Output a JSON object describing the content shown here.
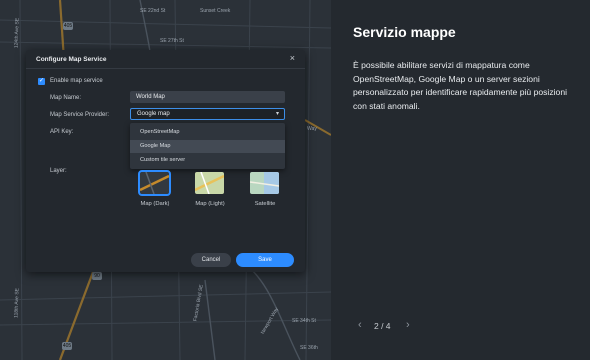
{
  "map": {
    "street_labels": {
      "se_22nd": "SE 22nd St",
      "se_27th": "SE 27th St",
      "sunset_creek": "Sunset Creek",
      "way": "Way",
      "ave_124th": "124th Ave SE",
      "ave_118th": "118th Ave SE",
      "factoria": "Factoria Blvd SE",
      "newport": "Newport Way",
      "se_34th": "SE 34th St",
      "se_36th": "SE 36th"
    },
    "shields": [
      "405",
      "90",
      "405"
    ]
  },
  "dialog": {
    "title": "Configure Map Service",
    "close_glyph": "×",
    "enable_label": "Enable map service",
    "map_name_label": "Map Name:",
    "map_name_value": "World Map",
    "provider_label": "Map Service Provider:",
    "provider_value": "Google map",
    "provider_options": [
      "OpenStreetMap",
      "Google Map",
      "Custom tile server"
    ],
    "api_key_label": "API Key:",
    "layer_label": "Layer:",
    "layers": [
      {
        "label": "Map (Dark)",
        "selected": true
      },
      {
        "label": "Map (Light)",
        "selected": false
      },
      {
        "label": "Satellite",
        "selected": false
      }
    ],
    "cancel_label": "Cancel",
    "save_label": "Save"
  },
  "info": {
    "title": "Servizio mappe",
    "body": "È possibile abilitare servizi di mappatura come OpenStreetMap, Google Map o un server sezioni personalizzato per identificare rapidamente più posizioni con stati anomali.",
    "pager": {
      "current": "2",
      "total": "4",
      "text": "2 / 4",
      "prev_glyph": "‹",
      "next_glyph": "›"
    }
  },
  "colors": {
    "accent": "#2d8cff",
    "panel": "#24292f",
    "dialog": "#23282e"
  }
}
